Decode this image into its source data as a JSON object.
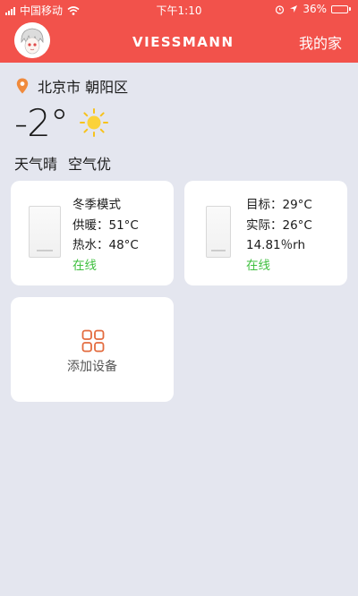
{
  "status_bar": {
    "carrier": "中国移动",
    "time": "下午1:10",
    "battery": "36%",
    "battery_level": 0.36
  },
  "header": {
    "brand": "VIESSMANN",
    "my_home": "我的家"
  },
  "location": {
    "city": "北京市",
    "district": "朝阳区"
  },
  "weather": {
    "temperature": "-2°",
    "condition": "天气晴",
    "air_quality": "空气优",
    "icon": "sun-icon"
  },
  "devices": [
    {
      "lines": [
        "冬季模式",
        "供暖：51°C",
        "热水：48°C"
      ],
      "status": "在线"
    },
    {
      "lines": [
        "目标：29°C",
        "实际：26°C",
        "14.81％rh"
      ],
      "status": "在线"
    }
  ],
  "add_device": {
    "label": "添加设备",
    "icon": "grid-icon"
  },
  "colors": {
    "header": "#f2524b",
    "background": "#e4e6ef",
    "online": "#3fbf3f",
    "accent": "#e36b3e"
  }
}
